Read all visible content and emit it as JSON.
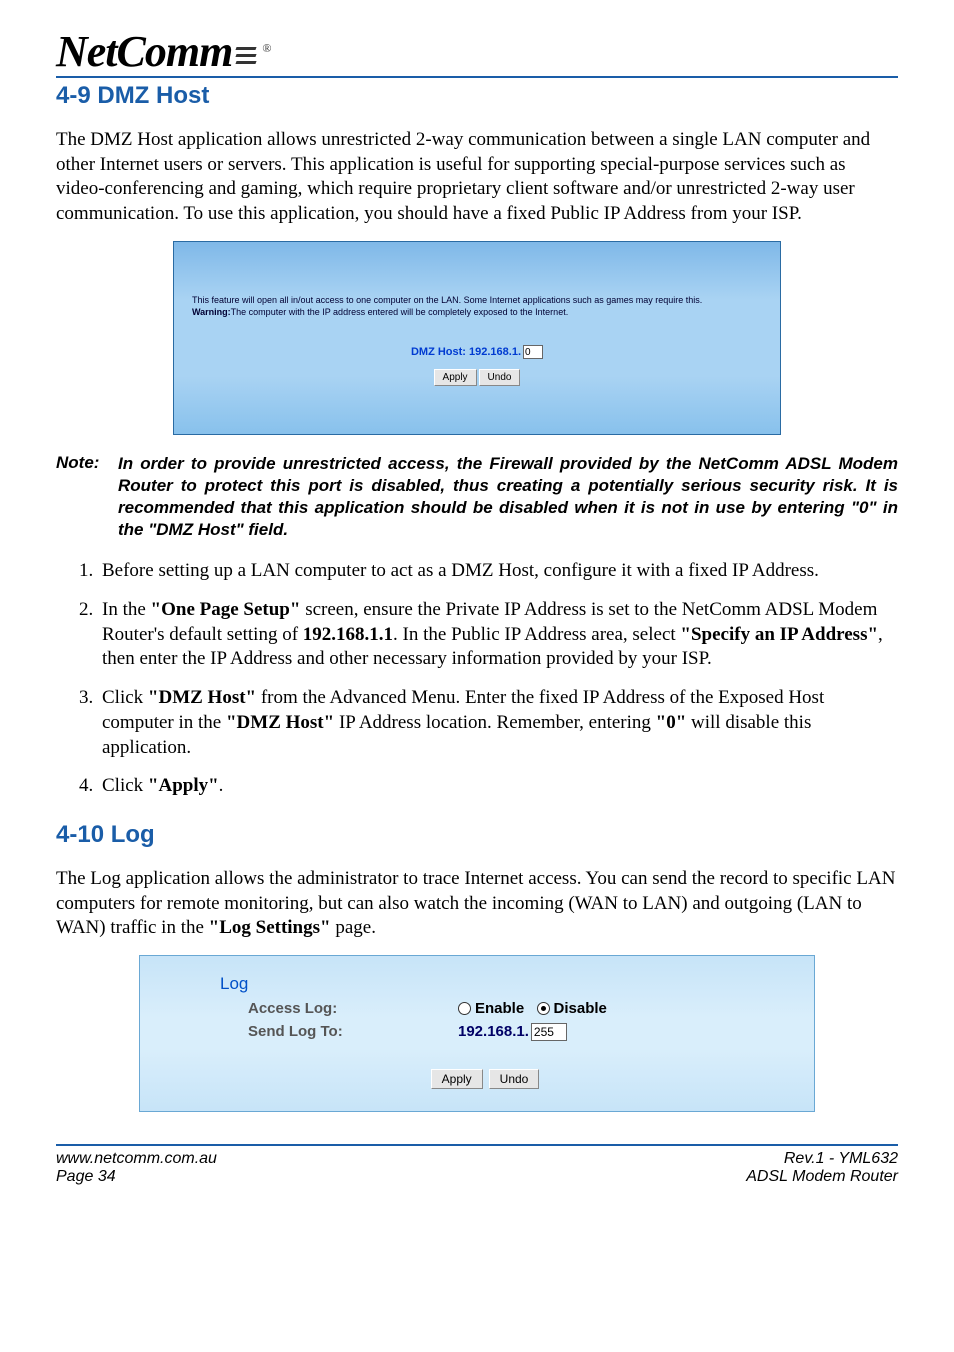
{
  "brand": {
    "name": "NetComm",
    "registered": "®"
  },
  "section1": {
    "heading": "4-9 DMZ Host",
    "intro": "The DMZ Host application allows unrestricted 2-way communication between a single LAN computer and other Internet users or servers. This application is useful for supporting special-purpose services such as video-conferencing and gaming, which require proprietary client software and/or unrestricted 2-way user communication. To use this application, you should have a fixed Public IP Address from your ISP."
  },
  "dmz_screenshot": {
    "desc": "This feature will open all in/out access to one computer on the LAN. Some Internet applications such as games may require this.",
    "warning_label": "Warning:",
    "warning_text": "The computer with the IP address entered will be completely exposed to the Internet.",
    "host_label": "DMZ Host: 192.168.1.",
    "host_value": "0",
    "apply": "Apply",
    "undo": "Undo"
  },
  "note": {
    "label": "Note:",
    "text": "In order to provide unrestricted access, the Firewall provided by the NetComm ADSL Modem Router to protect this port is disabled, thus creating a potentially serious security risk. It is recommended that this application should be disabled when it is not in use by entering \"0\" in the \"DMZ Host\" field."
  },
  "steps": [
    {
      "html": "Before setting up a LAN computer to act as a DMZ Host, configure it with a fixed IP Address."
    },
    {
      "html": "In the <b>\"One Page Setup\"</b> screen, ensure the Private IP Address is set to the NetComm ADSL Modem Router's default setting of <b>192.168.1.1</b>. In the Public IP Address area, select <b>\"Specify an IP Address\"</b>, then enter the IP Address and other necessary information provided by your ISP."
    },
    {
      "html": "Click <b>\"DMZ Host\"</b> from the Advanced Menu. Enter the fixed IP Address of the Exposed Host computer in the <b>\"DMZ Host\"</b> IP Address location. Remember, entering <b>\"0\"</b> will disable this application."
    },
    {
      "html": "Click <b>\"Apply\"</b>."
    }
  ],
  "section2": {
    "heading": "4-10 Log",
    "intro_html": "The Log application allows the administrator to trace Internet access. You can send the record to specific LAN computers for remote monitoring, but can also watch the incoming (WAN to LAN) and outgoing (LAN to WAN) traffic in the <b>\"Log Settings\"</b> page."
  },
  "log_screenshot": {
    "title": "Log",
    "row1_label": "Access Log:",
    "enable": "Enable",
    "disable": "Disable",
    "selected": "disable",
    "row2_label": "Send Log To:",
    "ip_prefix": "192.168.1.",
    "ip_value": "255",
    "apply": "Apply",
    "undo": "Undo"
  },
  "footer": {
    "url": "www.netcomm.com.au",
    "page": "Page 34",
    "rev": "Rev.1 - YML632",
    "product": "ADSL Modem Router"
  }
}
